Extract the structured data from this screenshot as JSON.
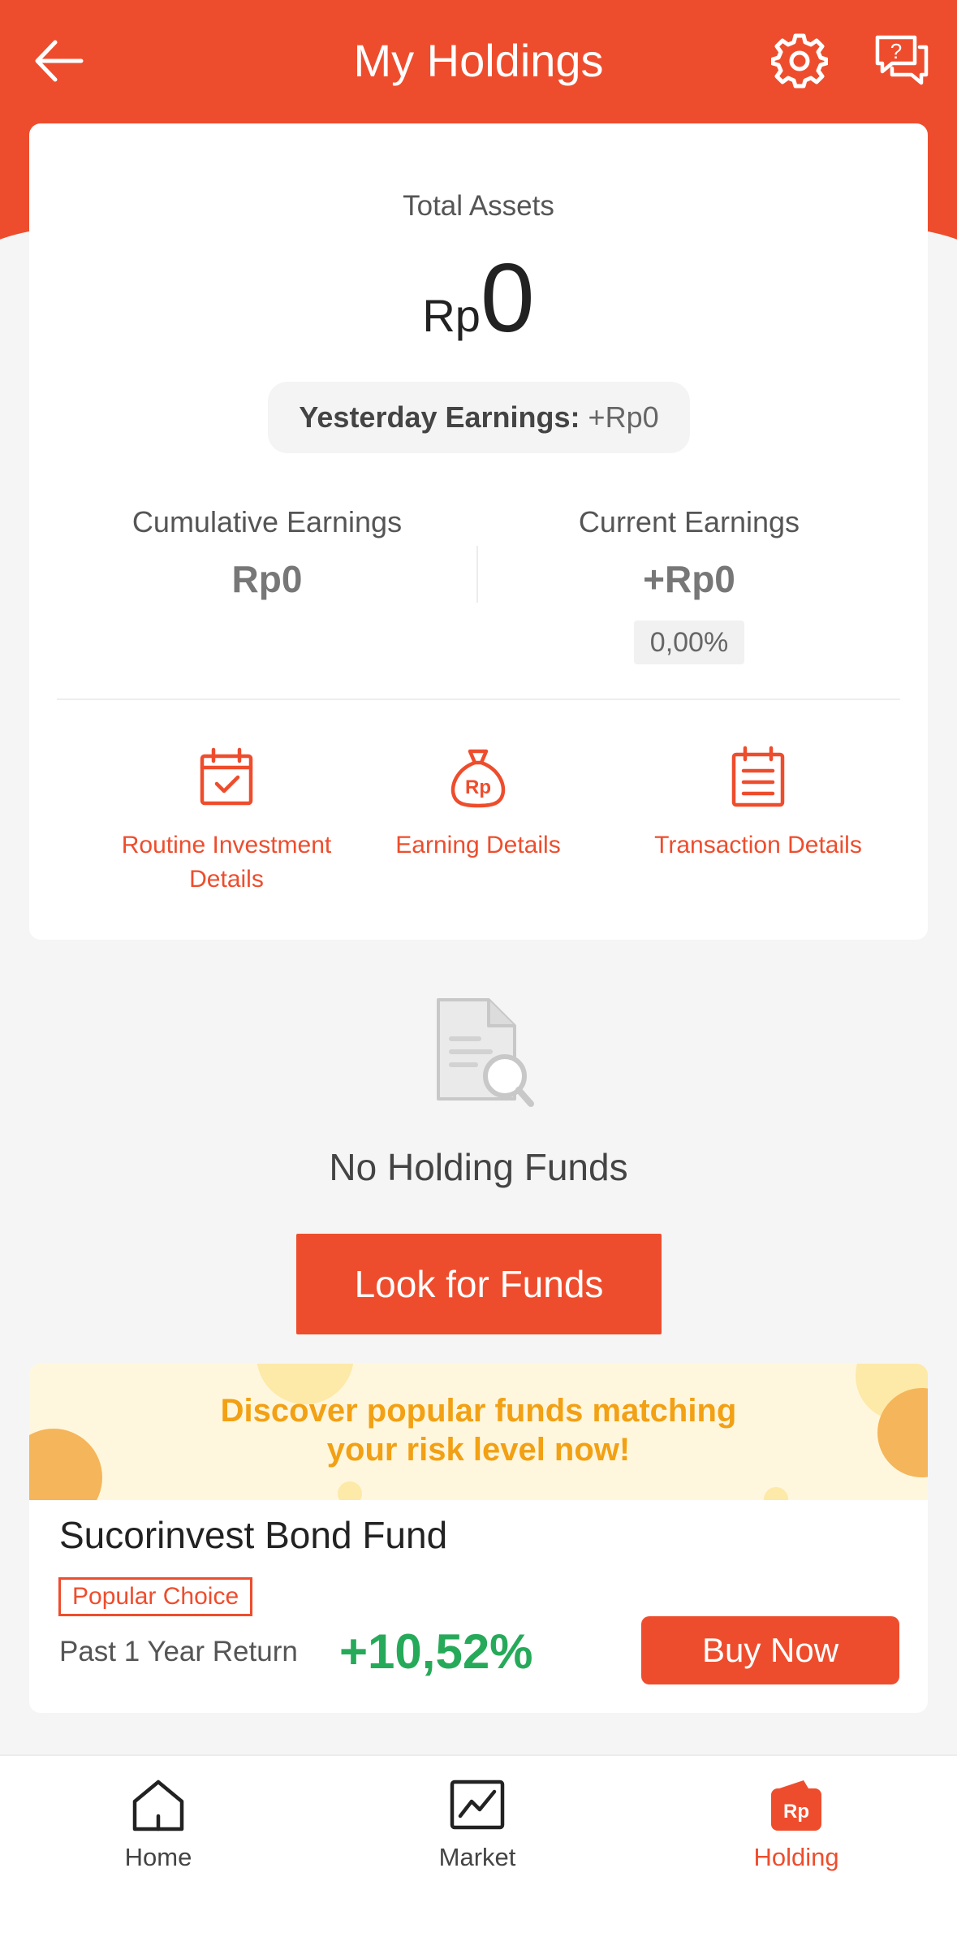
{
  "header": {
    "title": "My Holdings",
    "icons": [
      "back-arrow-icon",
      "gear-icon",
      "chat-help-icon"
    ]
  },
  "assets": {
    "label": "Total Assets",
    "currency": "Rp",
    "value": "0",
    "yesterday_label": "Yesterday Earnings:",
    "yesterday_value": "+Rp0"
  },
  "earnings": {
    "cumulative_label": "Cumulative Earnings",
    "cumulative_value": "Rp0",
    "current_label": "Current Earnings",
    "current_value": "+Rp0",
    "current_percent": "0,00%"
  },
  "shortcuts": [
    {
      "label": "Routine Investment Details",
      "icon": "calendar-check-icon"
    },
    {
      "label": "Earning Details",
      "icon": "money-bag-icon"
    },
    {
      "label": "Transaction Details",
      "icon": "calendar-list-icon"
    }
  ],
  "empty": {
    "title": "No Holding Funds",
    "button": "Look for Funds"
  },
  "promo": {
    "line1": "Discover popular funds matching",
    "line2": "your risk level now!"
  },
  "fund": {
    "name": "Sucorinvest Bond Fund",
    "tag": "Popular Choice",
    "return_label": "Past 1 Year Return",
    "return_value": "+10,52%",
    "buy_label": "Buy Now"
  },
  "nav": {
    "items": [
      {
        "label": "Home",
        "icon": "home-icon"
      },
      {
        "label": "Market",
        "icon": "chart-icon"
      },
      {
        "label": "Holding",
        "icon": "rp-wallet-icon",
        "badge": "Rp"
      }
    ],
    "active": "Holding"
  },
  "colors": {
    "brand": "#ee4d2d",
    "positive": "#26aa5a",
    "promo_text": "#f2a014",
    "promo_bg": "#fff7dd"
  }
}
